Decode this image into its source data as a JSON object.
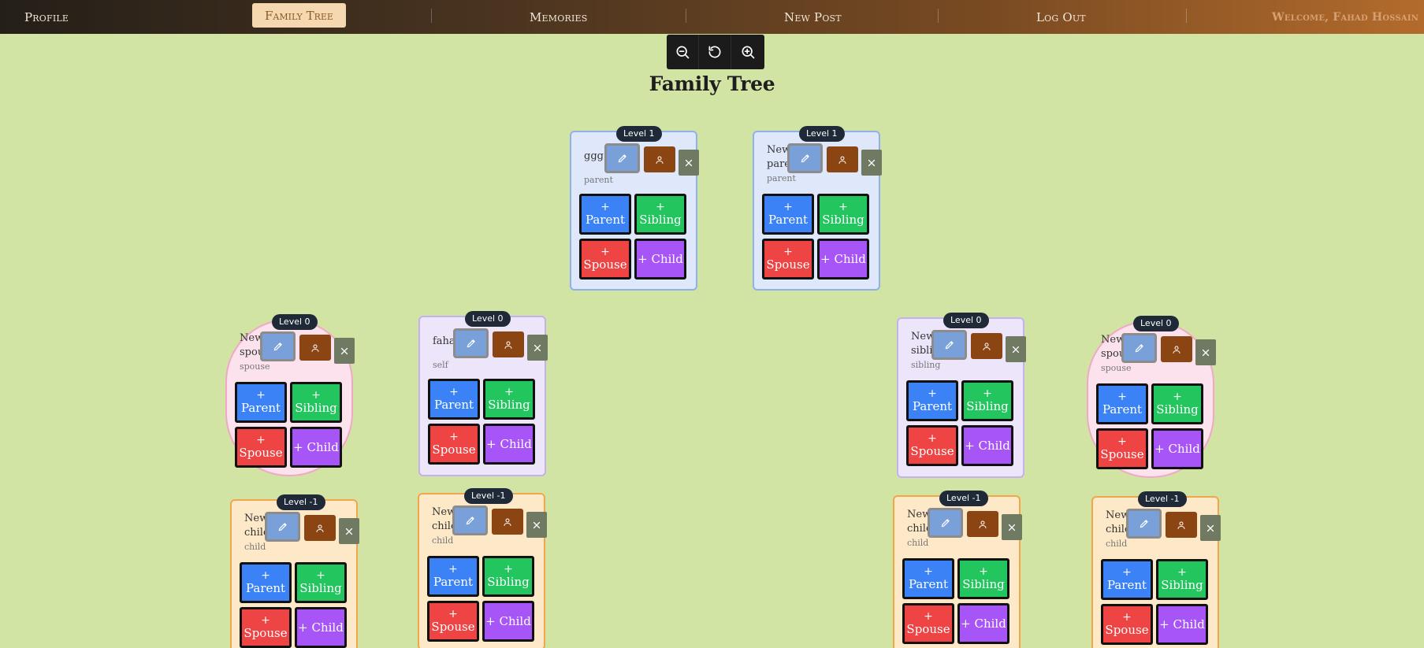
{
  "nav": {
    "profile": "Profile",
    "family_tree": "Family Tree",
    "memories": "Memories",
    "new_post": "New Post",
    "logout": "Log Out",
    "welcome": "Welcome, Fahad Hossain"
  },
  "zoom": {
    "out_icon": "zoom-out-icon",
    "reset_icon": "reset-icon",
    "in_icon": "zoom-in-icon"
  },
  "title": "Family Tree",
  "actions": {
    "plus": "+",
    "parent": "Parent",
    "sibling": "Sibling",
    "spouse": "Spouse",
    "child": "+ Child"
  },
  "cards": [
    {
      "level": "Level 1",
      "name": "ggg",
      "role": "parent"
    },
    {
      "level": "Level 1",
      "name": "New parent",
      "role": "parent"
    },
    {
      "level": "Level 0",
      "name": "New spouse",
      "role": "spouse"
    },
    {
      "level": "Level 0",
      "name": "fahad",
      "role": "self"
    },
    {
      "level": "Level 0",
      "name": "New sibling",
      "role": "sibling"
    },
    {
      "level": "Level 0",
      "name": "New spouse",
      "role": "spouse"
    },
    {
      "level": "Level -1",
      "name": "New child",
      "role": "child"
    },
    {
      "level": "Level -1",
      "name": "New child",
      "role": "child"
    },
    {
      "level": "Level -1",
      "name": "New child",
      "role": "child"
    },
    {
      "level": "Level -1",
      "name": "New child",
      "role": "child"
    }
  ],
  "colors": {
    "parent": "#3b82f6",
    "sibling": "#22c55e",
    "spouse": "#ef4444",
    "child": "#a855f7",
    "person": "#8b4513"
  }
}
